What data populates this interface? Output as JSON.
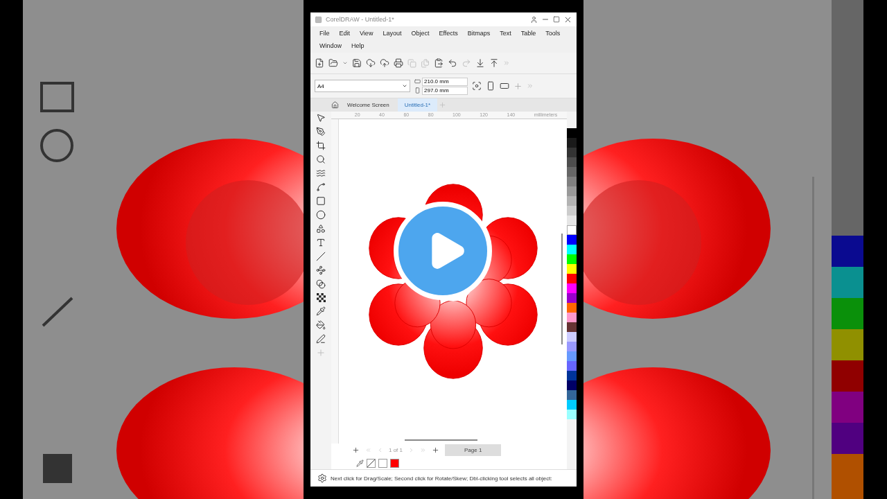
{
  "window": {
    "title": "CorelDRAW - Untitled-1*"
  },
  "menu": [
    "File",
    "Edit",
    "View",
    "Layout",
    "Object",
    "Effects",
    "Bitmaps",
    "Text",
    "Table",
    "Tools",
    "Window",
    "Help"
  ],
  "property_bar": {
    "page_size": "A4",
    "width": "210.0 mm",
    "height": "297.0 mm"
  },
  "document_tabs": [
    {
      "label": "Welcome Screen",
      "selected": false
    },
    {
      "label": "Untitled-1*",
      "selected": true
    }
  ],
  "ruler": {
    "ticks": [
      "20",
      "40",
      "60",
      "80",
      "100",
      "120",
      "140"
    ],
    "unit": "millimeters"
  },
  "page_navigator": {
    "counter": "1 of 1",
    "page_tab": "Page 1"
  },
  "document_palette": [
    {
      "kind": "none"
    },
    {
      "kind": "swatch",
      "color": "#ffffff"
    },
    {
      "kind": "swatch",
      "color": "#ff0000"
    }
  ],
  "color_palette": [
    {
      "color": "#000000"
    },
    {
      "color": "#1a1a1a"
    },
    {
      "color": "#333333"
    },
    {
      "color": "#4d4d4d"
    },
    {
      "color": "#666666"
    },
    {
      "color": "#808080"
    },
    {
      "color": "#999999"
    },
    {
      "color": "#b3b3b3"
    },
    {
      "color": "#cccccc"
    },
    {
      "color": "#e6e6e6"
    },
    {
      "color": "#ffffff"
    },
    {
      "color": "#0000ff"
    },
    {
      "color": "#00ffff"
    },
    {
      "color": "#00ff00"
    },
    {
      "color": "#ffff00"
    },
    {
      "color": "#ff0000"
    },
    {
      "color": "#ff00ff"
    },
    {
      "color": "#9900cc"
    },
    {
      "color": "#ff6600"
    },
    {
      "color": "#ff99cc"
    },
    {
      "color": "#663333"
    },
    {
      "color": "#ccccff"
    },
    {
      "color": "#9999ff"
    },
    {
      "color": "#6699ff"
    },
    {
      "color": "#6666ff"
    },
    {
      "color": "#003399"
    },
    {
      "color": "#000066"
    },
    {
      "color": "#336699"
    },
    {
      "color": "#00ccff"
    },
    {
      "color": "#99ffff"
    }
  ],
  "status_bar": {
    "text": "Next click for Drag/Scale; Second click for Rotate/Skew; Dbl-clicking tool selects all object:"
  },
  "overlay": {
    "kind": "play"
  }
}
